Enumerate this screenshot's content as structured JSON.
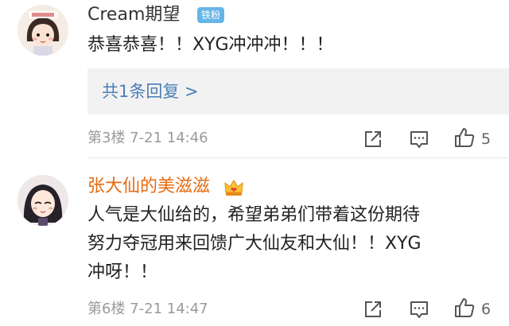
{
  "comments": [
    {
      "username": "Cream期望",
      "badge": "铁粉",
      "text": "恭喜恭喜！！XYG冲冲冲！！！",
      "reply_link": "共1条回复 >",
      "floor_time": "第3楼  7-21 14:46",
      "like_count": "5",
      "avatar_icon": "avatar-cartoon-girl-icon"
    },
    {
      "username": "张大仙的美滋滋",
      "badge_icon": "vip-crown-icon",
      "text_lines": [
        "人气是大仙给的，希望弟弟们带着这份期待",
        "努力夺冠用来回馈广大仙友和大仙！！XYG",
        "冲呀！！"
      ],
      "floor_time": "第6楼  7-21 14:47",
      "like_count": "6",
      "avatar_icon": "avatar-cartoon-girl-dark-icon"
    }
  ],
  "colors": {
    "username": "#333333",
    "vip_username": "#e86a10",
    "badge_bg": "#66b5e8",
    "link": "#4a7eb5",
    "meta": "#9a9a9a"
  }
}
